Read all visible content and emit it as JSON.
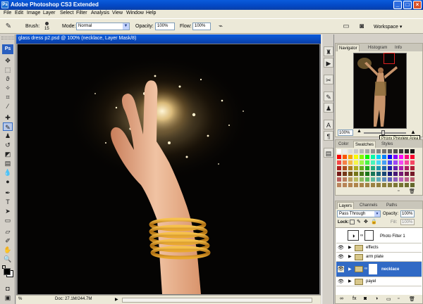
{
  "app": {
    "title": "Adobe Photoshop CS3 Extended",
    "logo": "Ps",
    "window_controls": [
      "_",
      "□",
      "×"
    ]
  },
  "menu": [
    "File",
    "Edit",
    "Image",
    "Layer",
    "Select",
    "Filter",
    "Analysis",
    "View",
    "Window",
    "Help"
  ],
  "options": {
    "brush_label": "Brush:",
    "brush_size": "15",
    "mode_label": "Mode:",
    "mode_value": "Normal",
    "opacity_label": "Opacity:",
    "opacity_value": "100%",
    "flow_label": "Flow:",
    "flow_value": "100%",
    "workspace_label": "Workspace ▾"
  },
  "document": {
    "title": "glass dress p2.psd @ 100% (necklace, Layer Mask/8)",
    "zoom": "%",
    "doc_info": "Doc: 27.1M/244.7M"
  },
  "navigator": {
    "tabs": [
      "Navigator",
      "Histogram",
      "Info"
    ],
    "tooltip": "Proxy Preview Area",
    "zoom": "100%",
    "slider_fraction": 0.45
  },
  "swatches": {
    "tabs": [
      "Color",
      "Swatches",
      "Styles"
    ]
  },
  "layers": {
    "tabs": [
      "Layers",
      "Channels",
      "Paths"
    ],
    "blend_mode": "Pass Through",
    "opacity_label": "Opacity:",
    "opacity_value": "100%",
    "lock_label": "Lock:",
    "fill_label": "Fill:",
    "fill_value": "100%",
    "rows": [
      {
        "name": "Photo Filter 1",
        "type": "adjustment",
        "selected": false
      },
      {
        "name": "effects",
        "type": "group",
        "selected": false
      },
      {
        "name": "arm plate",
        "type": "group",
        "selected": false
      },
      {
        "name": "necklace",
        "type": "group-mask",
        "selected": true
      },
      {
        "name": "payel",
        "type": "group",
        "selected": false
      }
    ]
  },
  "colors": {
    "titlebar": "#0a4fd0",
    "selected_row": "#316ac5",
    "canvas_bg": "#050403"
  }
}
